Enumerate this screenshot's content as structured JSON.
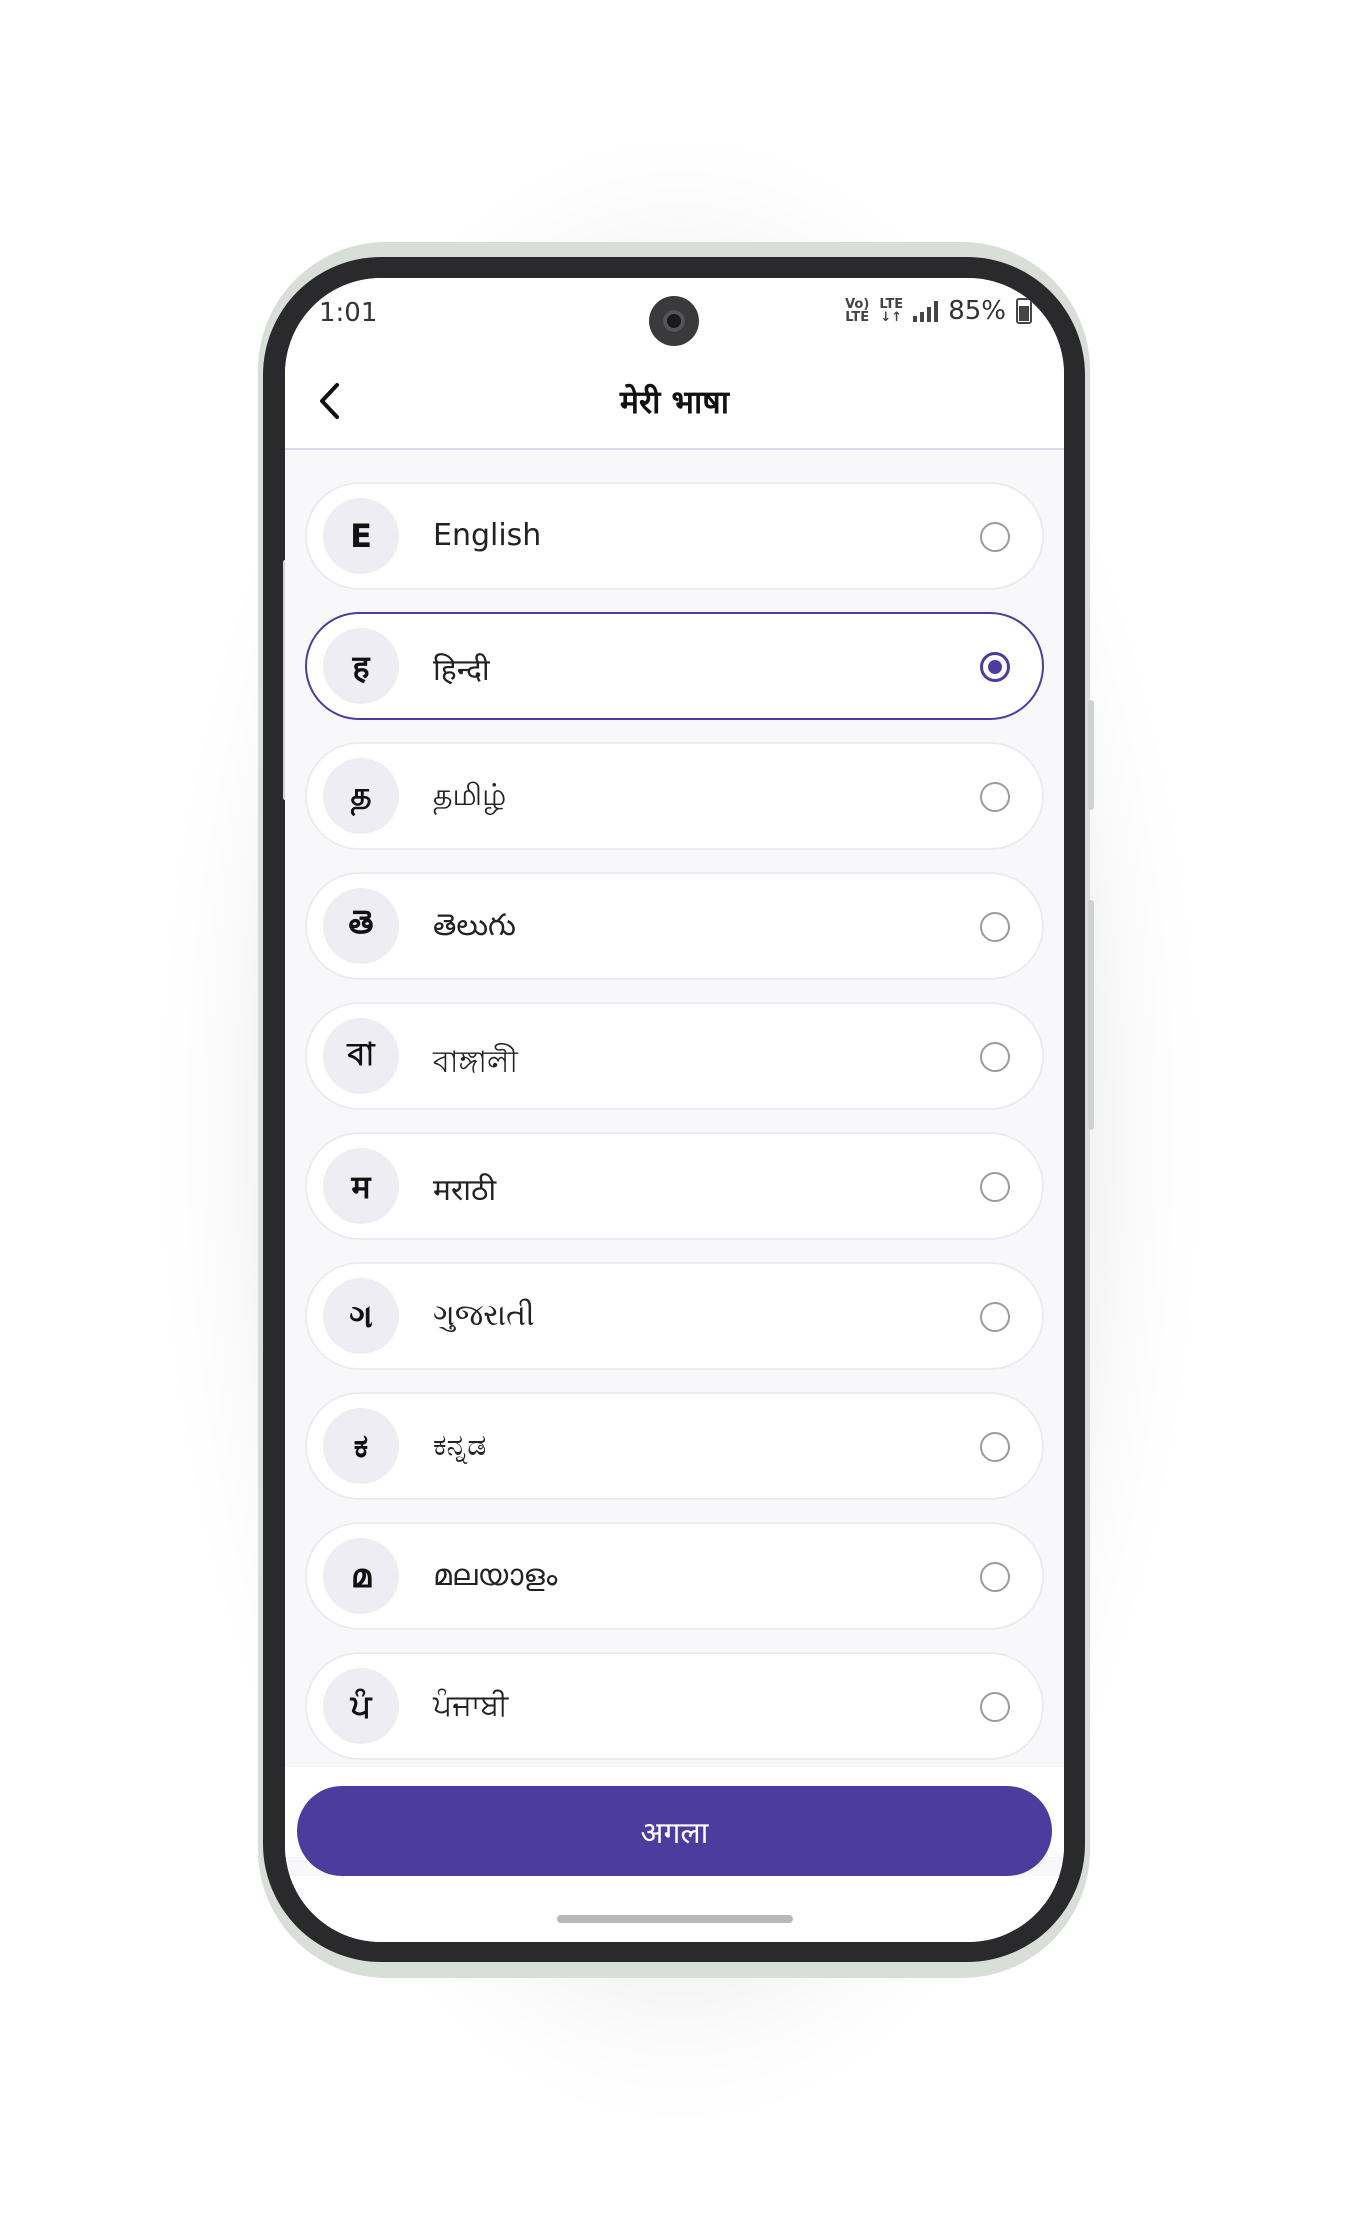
{
  "status_bar": {
    "time": "1:01",
    "network_label_1": "Vo)) LTE",
    "network_label_2": "LTE ↓↑",
    "battery": "85%"
  },
  "header": {
    "title": "मेरी भाषा",
    "back_icon": "chevron-left-icon"
  },
  "languages": [
    {
      "glyph": "E",
      "name": "English",
      "selected": false
    },
    {
      "glyph": "ह",
      "name": "हिन्दी",
      "selected": true
    },
    {
      "glyph": "த",
      "name": "தமிழ்",
      "selected": false
    },
    {
      "glyph": "తె",
      "name": "తెలుగు",
      "selected": false
    },
    {
      "glyph": "বা",
      "name": "বাঙ্গালী",
      "selected": false
    },
    {
      "glyph": "म",
      "name": "मराठी",
      "selected": false
    },
    {
      "glyph": "ગ",
      "name": "ગુજરાતી",
      "selected": false
    },
    {
      "glyph": "ಕ",
      "name": "ಕನ್ನಡ",
      "selected": false
    },
    {
      "glyph": "മ",
      "name": "മലയാളം",
      "selected": false
    },
    {
      "glyph": "ਪੰ",
      "name": "ਪੰਜਾਬੀ",
      "selected": false
    }
  ],
  "footer": {
    "next_label": "अगला"
  },
  "colors": {
    "accent": "#4b3c9e",
    "glyph_bg": "#eeedf3"
  }
}
